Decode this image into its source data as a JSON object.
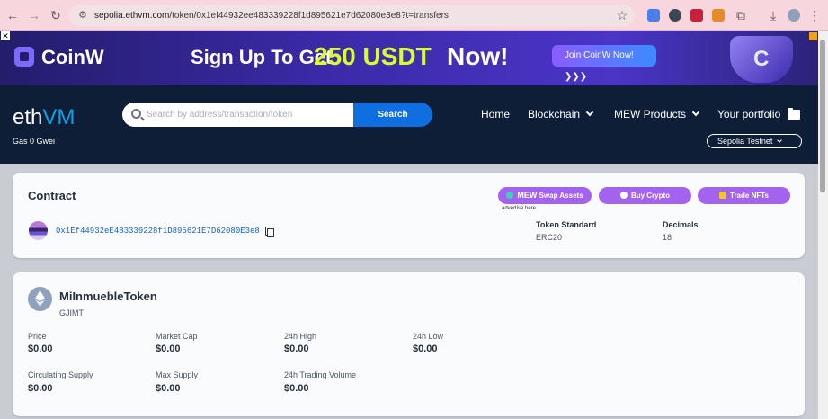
{
  "browser": {
    "url_host": "sepolia.ethvm.com",
    "url_path": "/token/0x1ef44932ee483339228f1d895621e7d62080e3e8?t=transfers"
  },
  "ad": {
    "close": "✕",
    "logo": "CoinW",
    "headline_1": "Sign Up To Get",
    "headline_2": "250 USDT",
    "headline_3": "Now!",
    "button": "Join CoinW Now!",
    "button_arrows": "❯❯❯"
  },
  "header": {
    "brand_a": "eth",
    "brand_b": "VM",
    "gas": "Gas 0 Gwei",
    "search_placeholder": "Search by address/transaction/token",
    "search_button": "Search",
    "nav": {
      "home": "Home",
      "blockchain": "Blockchain",
      "mew_products": "MEW Products",
      "portfolio": "Your portfolio"
    },
    "network": "Sepolia Testnet"
  },
  "contract": {
    "title": "Contract",
    "promo": {
      "swap_brand": "MEW",
      "swap": "Swap Assets",
      "buy": "Buy Crypto",
      "nfts": "Trade NFTs",
      "advertise": "advertise here"
    },
    "address": "0x1Ef44932eE483339228f1D895621E7D62080E3e8",
    "token_standard_label": "Token Standard",
    "token_standard": "ERC20",
    "decimals_label": "Decimals",
    "decimals": "18"
  },
  "token": {
    "name": "MiInmuebleToken",
    "symbol": "GJIMT",
    "stats": {
      "price_label": "Price",
      "price": "$0.00",
      "market_cap_label": "Market Cap",
      "market_cap": "$0.00",
      "high_label": "24h High",
      "high": "$0.00",
      "low_label": "24h Low",
      "low": "$0.00",
      "circ_label": "Circulating Supply",
      "circ": "$0.00",
      "max_label": "Max Supply",
      "max": "$0.00",
      "vol_label": "24h Trading Volume",
      "vol": "$0.00"
    }
  },
  "colors": {
    "header_bg": "#0d1e36",
    "accent_blue": "#0f6fe0",
    "promo_purple": "#a463ee",
    "address_blue": "#1463c9"
  }
}
